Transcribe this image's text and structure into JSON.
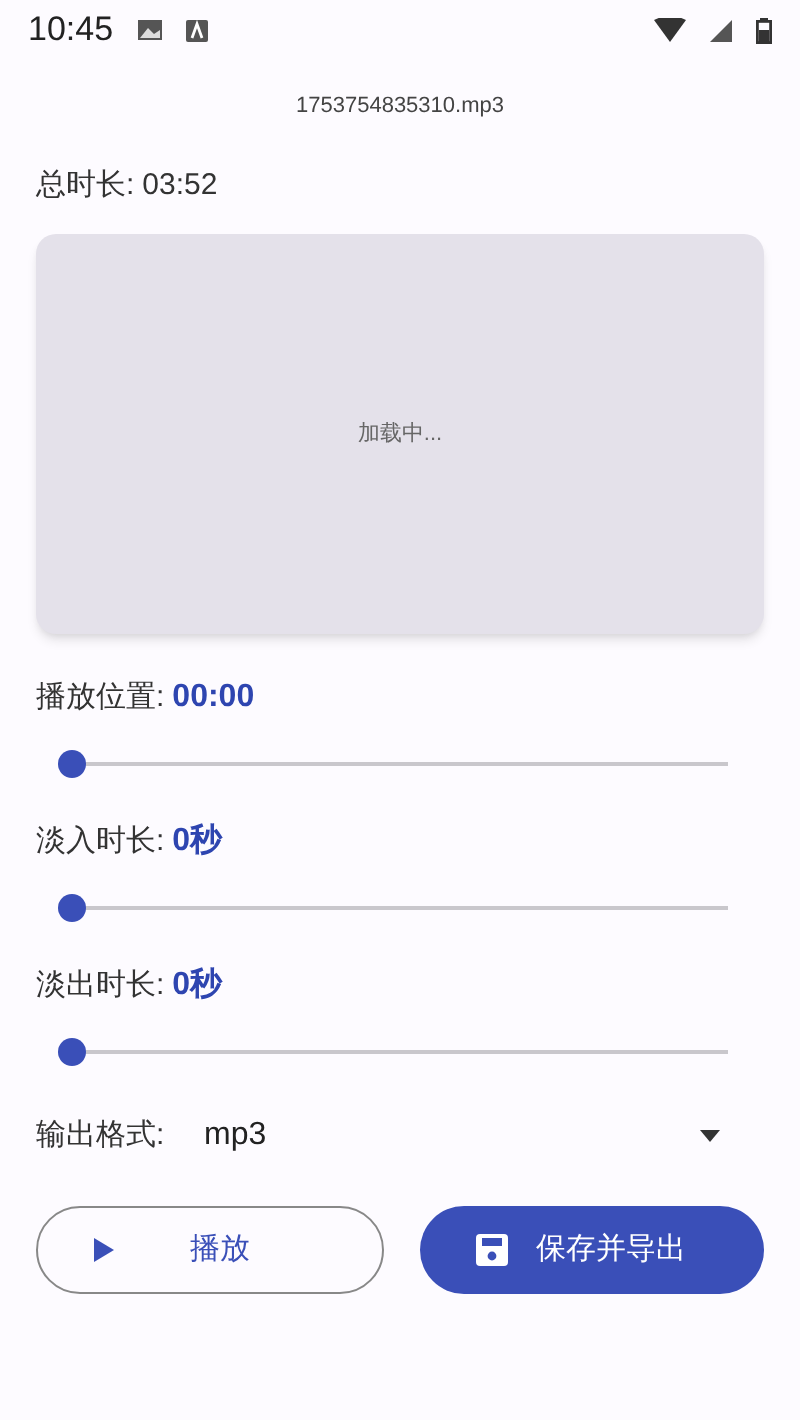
{
  "status_bar": {
    "time": "10:45"
  },
  "file_name": "1753754835310.mp3",
  "total_duration": {
    "label": "总时长:",
    "value": "03:52"
  },
  "waveform": {
    "loading_text": "加载中..."
  },
  "sliders": [
    {
      "label": "播放位置:",
      "value": "00:00",
      "level": 0
    },
    {
      "label": "淡入时长:",
      "value": "0秒",
      "level": 0
    },
    {
      "label": "淡出时长:",
      "value": "0秒",
      "level": 0
    }
  ],
  "output_format": {
    "label": "输出格式:",
    "value": "mp3"
  },
  "buttons": [
    {
      "label": "播放",
      "kind": "outlined"
    },
    {
      "label": "保存并导出",
      "kind": "filled"
    }
  ]
}
